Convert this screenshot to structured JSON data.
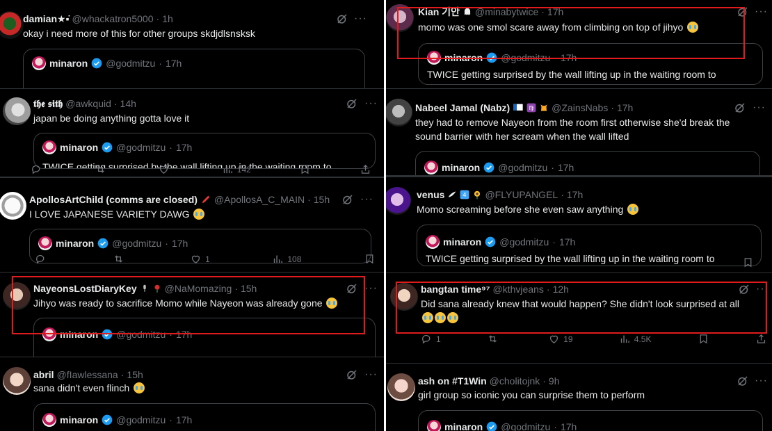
{
  "left_tweets": [
    {
      "name": "damian★▪︎̇",
      "handle": "@whackatron5000",
      "time": "1h",
      "text": "okay i need more of this for other groups skdjdlsnsksk",
      "emoji": false,
      "quote": {
        "name": "minaron",
        "handle": "@godmitzu",
        "time": "17h",
        "text": ""
      }
    },
    {
      "name": "𝖙𝖍𝖊 𝖘𝖎𝖙𝖍",
      "handle": "@awkquid",
      "time": "14h",
      "text": "japan be doing anything gotta love it",
      "emoji": false,
      "quote": {
        "name": "minaron",
        "handle": "@godmitzu",
        "time": "17h",
        "text": "TWICE getting surprised by the wall lifting up in the waiting room to"
      },
      "stats": {
        "replies": "",
        "reposts": "",
        "likes": "",
        "views": "142"
      }
    },
    {
      "name": "ApollosArtChild (comms are closed)",
      "handle": "@ApollosA_C_MAIN",
      "time": "15h",
      "text": "I LOVE JAPANESE VARIETY DAWG",
      "emoji": true,
      "quote": {
        "name": "minaron",
        "handle": "@godmitzu",
        "time": "17h",
        "text": ""
      },
      "stats": {
        "replies": "",
        "reposts": "",
        "likes": "1",
        "views": "108"
      }
    },
    {
      "name": "NayeonsLostDiaryKey",
      "handle": "@NaMomazing",
      "time": "15h",
      "text": "Jihyo was ready to sacrifice Momo while Nayeon was already gone",
      "emoji": true,
      "quote": {
        "name": "minaron",
        "handle": "@godmitzu",
        "time": "17h",
        "text": ""
      }
    },
    {
      "name": "abril",
      "handle": "@fIawlessana",
      "time": "15h",
      "text": "sana didn't even flinch",
      "emoji": true,
      "quote": {
        "name": "minaron",
        "handle": "@godmitzu",
        "time": "17h",
        "text": ""
      }
    }
  ],
  "right_tweets": [
    {
      "name": "Kian 기안",
      "handle": "@minabytwice",
      "time": "17h",
      "text": "momo was one smol scare away from climbing on top of jihyo",
      "emoji": true,
      "quote": {
        "name": "minaron",
        "handle": "@godmitzu",
        "time": "17h",
        "text": "TWICE getting surprised by the wall lifting up in the waiting room to"
      }
    },
    {
      "name": "Nabeel Jamal (Nabz)",
      "handle": "@ZainsNabs",
      "time": "17h",
      "text": "they had to remove Nayeon from the room first otherwise she'd break the",
      "text2": "sound barrier with her scream when the wall lifted",
      "emoji": false,
      "quote": {
        "name": "minaron",
        "handle": "@godmitzu",
        "time": "17h",
        "text": ""
      }
    },
    {
      "name": "venus",
      "handle": "@FLYUPANGEL",
      "time": "17h",
      "text": "Momo screaming before she even saw anything",
      "emoji": true,
      "quote": {
        "name": "minaron",
        "handle": "@godmitzu",
        "time": "17h",
        "text": "TWICE getting surprised by the wall lifting up in the waiting room to"
      }
    },
    {
      "name": "bangtan time⁹⁷",
      "handle": "@kthvjeans",
      "time": "12h",
      "text": "Did sana already knew that would happen? She didn't look surprised at all",
      "emoji": false,
      "stats": {
        "replies": "1",
        "reposts": "",
        "likes": "19",
        "views": "4.5K"
      }
    },
    {
      "name": "ash on #T1Win",
      "handle": "@cholitojnk",
      "time": "9h",
      "text": "girl group so iconic you can surprise them to perform",
      "emoji": false,
      "quote": {
        "name": "minaron",
        "handle": "@godmitzu",
        "time": "17h",
        "text": ""
      }
    }
  ],
  "dot": "·",
  "more": "···",
  "colors": {
    "highlight": "#e11b1b",
    "verified": "#1d9bf0",
    "background": "#000000"
  }
}
